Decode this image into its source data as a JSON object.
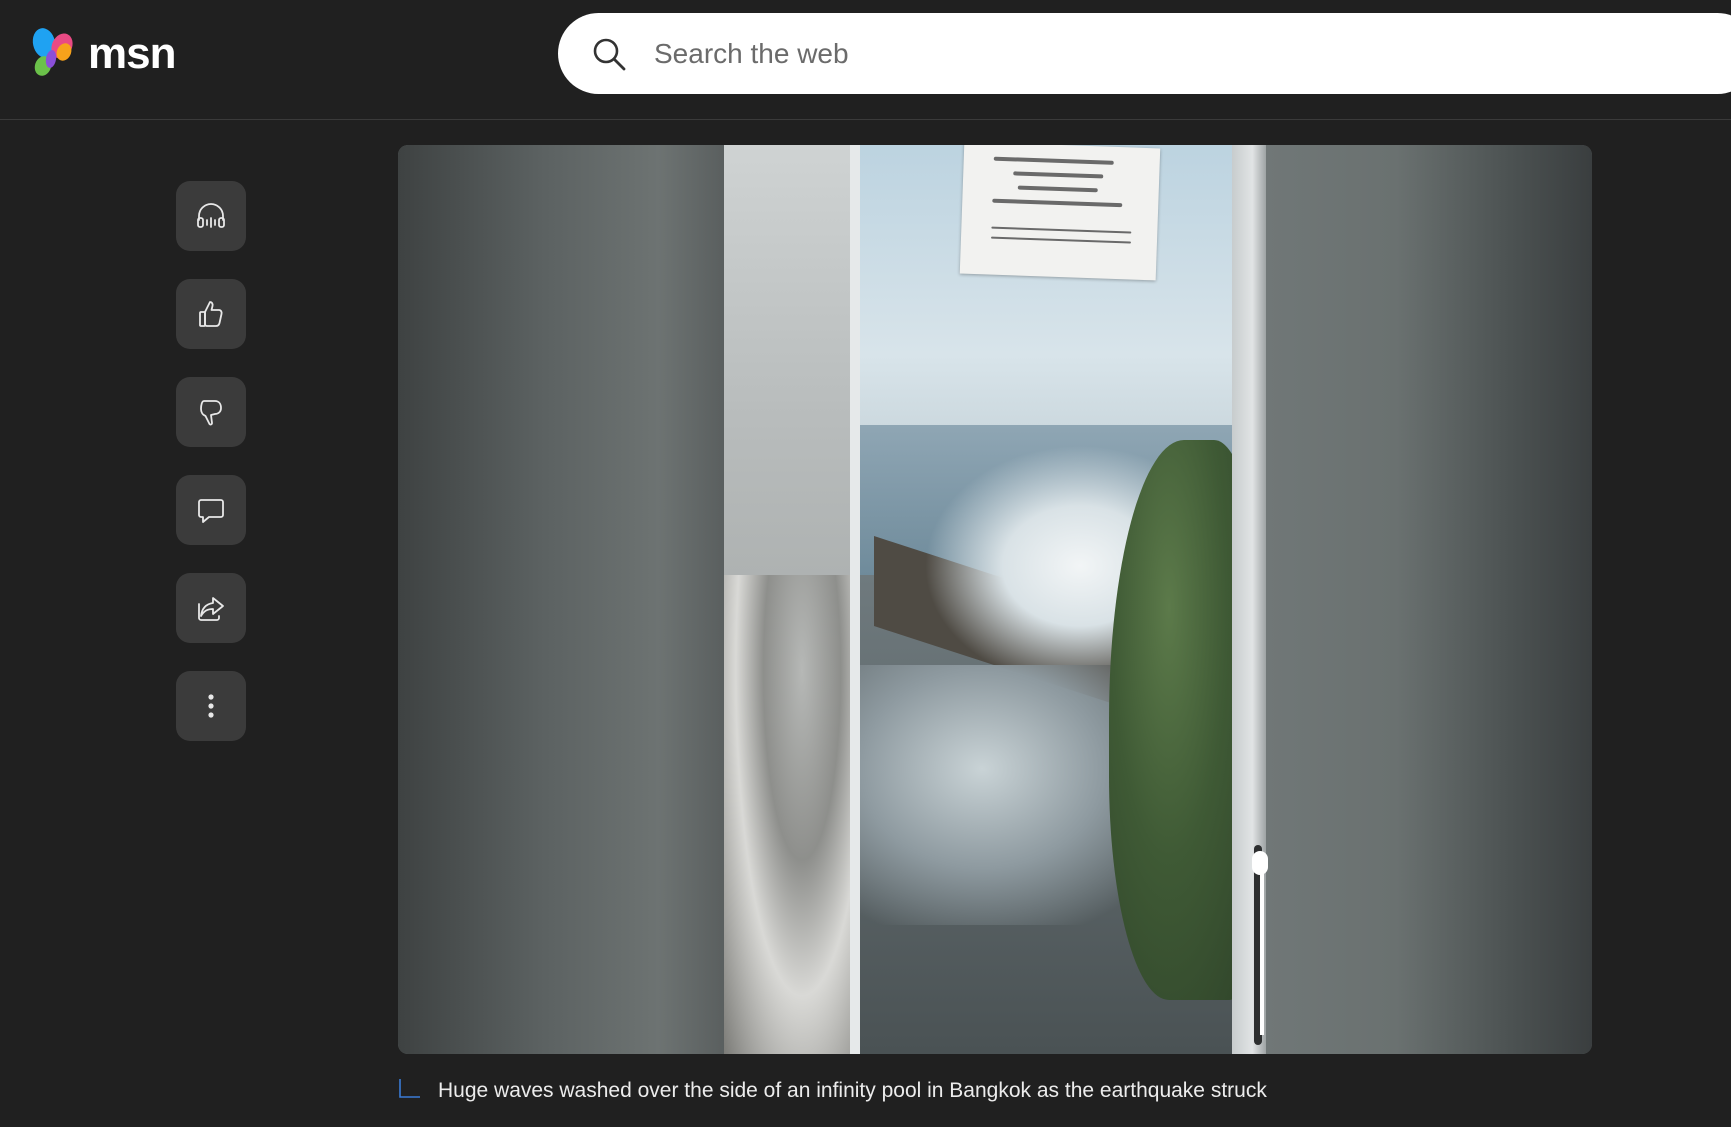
{
  "header": {
    "logo_text": "msn",
    "search": {
      "placeholder": "Search the web",
      "value": ""
    }
  },
  "rail": {
    "buttons": [
      {
        "icon": "headphones-icon",
        "action": "listen"
      },
      {
        "icon": "thumbs-up-icon",
        "action": "like"
      },
      {
        "icon": "thumbs-down-icon",
        "action": "dislike"
      },
      {
        "icon": "comment-icon",
        "action": "comment"
      },
      {
        "icon": "share-icon",
        "action": "share"
      },
      {
        "icon": "more-vertical-icon",
        "action": "more"
      }
    ]
  },
  "media": {
    "sign_lines": [
      "",
      "",
      "",
      ""
    ],
    "caption": "Huge waves washed over the side of an infinity pool in Bangkok as the earthquake struck"
  },
  "colors": {
    "background": "#202020",
    "rail_button": "#3b3b3b",
    "caption_accent": "#3a7bd5"
  }
}
